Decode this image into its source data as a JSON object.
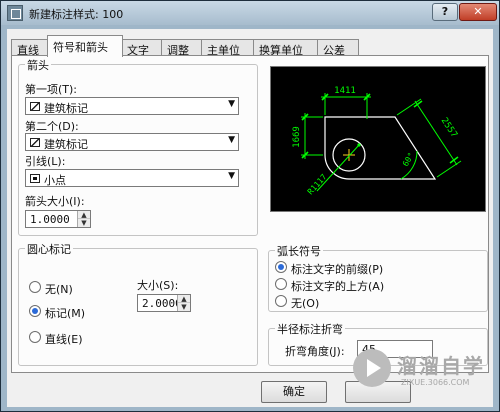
{
  "window": {
    "title": "新建标注样式: 100",
    "help_label": "?",
    "close_label": "✕"
  },
  "tabs": [
    {
      "label": "直线"
    },
    {
      "label": "符号和箭头"
    },
    {
      "label": "文字"
    },
    {
      "label": "调整"
    },
    {
      "label": "主单位"
    },
    {
      "label": "换算单位"
    },
    {
      "label": "公差"
    }
  ],
  "arrowheads": {
    "title": "箭头",
    "first_label": "第一项(T):",
    "first_value": "建筑标记",
    "second_label": "第二个(D):",
    "second_value": "建筑标记",
    "leader_label": "引线(L):",
    "leader_value": "小点",
    "size_label": "箭头大小(I):",
    "size_value": "1.0000"
  },
  "center_marks": {
    "title": "圆心标记",
    "options": [
      {
        "label": "无(N)",
        "selected": false
      },
      {
        "label": "标记(M)",
        "selected": true
      },
      {
        "label": "直线(E)",
        "selected": false
      }
    ],
    "size_label": "大小(S):",
    "size_value": "2.0000"
  },
  "arc_length": {
    "title": "弧长符号",
    "options": [
      {
        "label": "标注文字的前缀(P)",
        "selected": true
      },
      {
        "label": "标注文字的上方(A)",
        "selected": false
      },
      {
        "label": "无(O)",
        "selected": false
      }
    ]
  },
  "radius_jog": {
    "title": "半径标注折弯",
    "angle_label": "折弯角度(J):",
    "angle_value": "45"
  },
  "preview": {
    "dim_top": "1411",
    "dim_left": "1669",
    "dim_right": "2557",
    "dim_radius": "R1117",
    "dim_angle": "60°",
    "colors": {
      "background": "#000000",
      "geometry": "#ffffff",
      "dimension": "#00ff00",
      "accent": "#ffd21f"
    }
  },
  "buttons": {
    "ok": "确定"
  },
  "watermark": {
    "main": "溜溜自学",
    "sub": "ZIXUE.3066.COM"
  },
  "colors": {
    "frame": "#9fb6c8",
    "panel": "#fcfcfc",
    "radio_dot": "#2b6ad8",
    "close_button": "#c03e27"
  }
}
